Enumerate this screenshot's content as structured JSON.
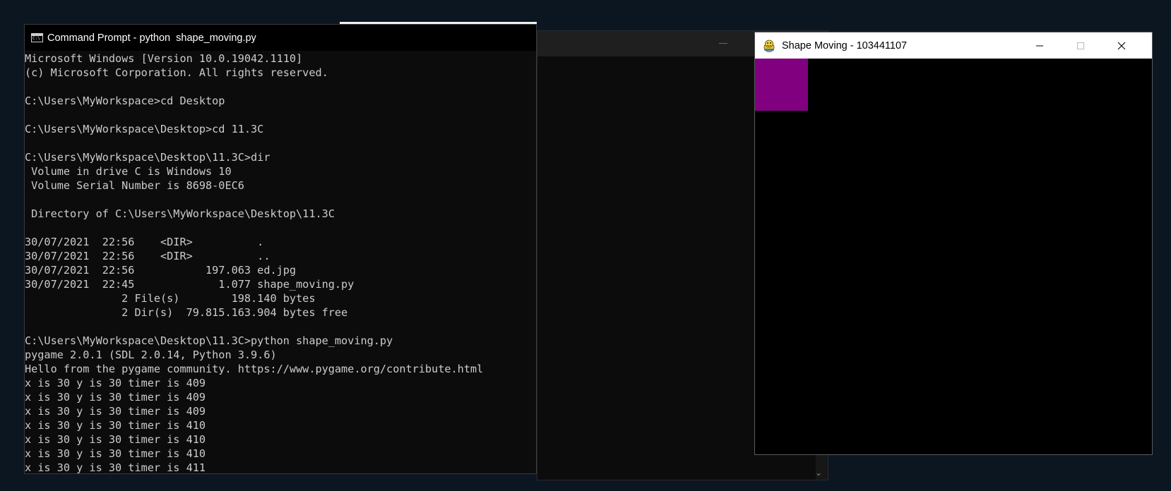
{
  "console_window": {
    "title": "Command Prompt - python  shape_moving.py",
    "lines": [
      "Microsoft Windows [Version 10.0.19042.1110]",
      "(c) Microsoft Corporation. All rights reserved.",
      "",
      "C:\\Users\\MyWorkspace>cd Desktop",
      "",
      "C:\\Users\\MyWorkspace\\Desktop>cd 11.3C",
      "",
      "C:\\Users\\MyWorkspace\\Desktop\\11.3C>dir",
      " Volume in drive C is Windows 10",
      " Volume Serial Number is 8698-0EC6",
      "",
      " Directory of C:\\Users\\MyWorkspace\\Desktop\\11.3C",
      "",
      "30/07/2021  22:56    <DIR>          .",
      "30/07/2021  22:56    <DIR>          ..",
      "30/07/2021  22:56           197.063 ed.jpg",
      "30/07/2021  22:45             1.077 shape_moving.py",
      "               2 File(s)        198.140 bytes",
      "               2 Dir(s)  79.815.163.904 bytes free",
      "",
      "C:\\Users\\MyWorkspace\\Desktop\\11.3C>python shape_moving.py",
      "pygame 2.0.1 (SDL 2.0.14, Python 3.9.6)",
      "Hello from the pygame community. https://www.pygame.org/contribute.html",
      "x is 30 y is 30 timer is 409",
      "x is 30 y is 30 timer is 409",
      "x is 30 y is 30 timer is 409",
      "x is 30 y is 30 timer is 410",
      "x is 30 y is 30 timer is 410",
      "x is 30 y is 30 timer is 410",
      "x is 30 y is 30 timer is 411"
    ],
    "icon": "cmd-icon"
  },
  "game_window": {
    "title": "Shape Moving - 103441107",
    "icon": "pygame-snake-icon",
    "controls": {
      "minimize_icon": "minimize-icon",
      "maximize_icon": "maximize-icon",
      "close_icon": "close-icon"
    },
    "shape_color": "#800080",
    "canvas_color": "#000000"
  },
  "background_window": {
    "scroll_down_icon": "chevron-down-icon"
  },
  "colors": {
    "desktop": "#0c1621",
    "console_text": "#cccccc",
    "console_bg": "#0c0c0c"
  }
}
